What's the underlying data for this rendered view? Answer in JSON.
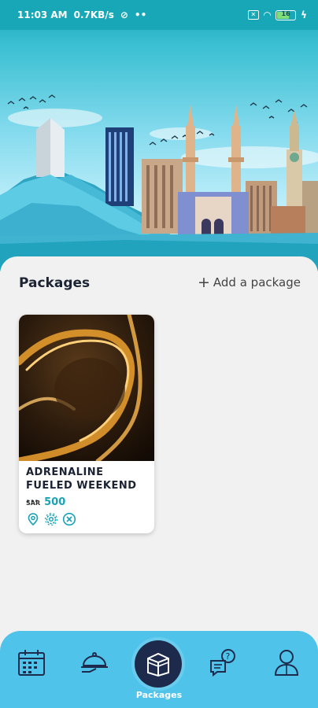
{
  "status_bar": {
    "time": "11:03 AM",
    "speed": "0.7KB/s",
    "battery": "16"
  },
  "packages": {
    "title": "Packages",
    "add_label": "Add a package",
    "items": [
      {
        "title": "ADRENALINE FUELED WEEKEND ...",
        "currency": "SAR",
        "price": "500",
        "icons": [
          "location-pin-icon",
          "settings-gear-icon",
          "remove-circle-icon"
        ]
      }
    ]
  },
  "nav": {
    "items": [
      {
        "icon": "calendar-icon"
      },
      {
        "icon": "food-cloche-icon"
      },
      {
        "icon": "kaaba-icon",
        "label": "Packages"
      },
      {
        "icon": "help-chat-icon"
      },
      {
        "icon": "profile-icon"
      }
    ]
  },
  "colors": {
    "accent": "#17a3b5",
    "nav": "#4fc3ea",
    "nav_active": "#1d2a4b"
  }
}
